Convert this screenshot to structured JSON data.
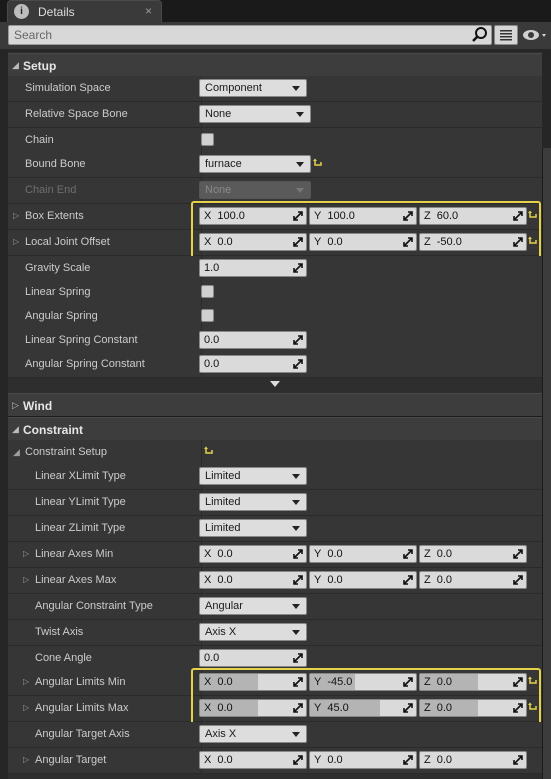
{
  "tab": {
    "title": "Details",
    "close": "×"
  },
  "search": {
    "placeholder": "Search"
  },
  "categories": {
    "setup": "Setup",
    "wind": "Wind",
    "constraint": "Constraint"
  },
  "setup": {
    "simulation_space": {
      "label": "Simulation Space",
      "value": "Component"
    },
    "relative_space_bone": {
      "label": "Relative Space Bone",
      "value": "None"
    },
    "chain": {
      "label": "Chain"
    },
    "bound_bone": {
      "label": "Bound Bone",
      "value": "furnace"
    },
    "chain_end": {
      "label": "Chain End",
      "value": "None"
    },
    "box_extents": {
      "label": "Box Extents",
      "x": "100.0",
      "y": "100.0",
      "z": "60.0"
    },
    "local_joint_offset": {
      "label": "Local Joint Offset",
      "x": "0.0",
      "y": "0.0",
      "z": "-50.0"
    },
    "gravity_scale": {
      "label": "Gravity Scale",
      "value": "1.0"
    },
    "linear_spring": {
      "label": "Linear Spring"
    },
    "angular_spring": {
      "label": "Angular Spring"
    },
    "linear_spring_constant": {
      "label": "Linear Spring Constant",
      "value": "0.0"
    },
    "angular_spring_constant": {
      "label": "Angular Spring Constant",
      "value": "0.0"
    }
  },
  "constraint": {
    "setup": {
      "label": "Constraint Setup"
    },
    "linear_xlimit_type": {
      "label": "Linear XLimit Type",
      "value": "Limited"
    },
    "linear_ylimit_type": {
      "label": "Linear YLimit Type",
      "value": "Limited"
    },
    "linear_zlimit_type": {
      "label": "Linear ZLimit Type",
      "value": "Limited"
    },
    "linear_axes_min": {
      "label": "Linear Axes Min",
      "x": "0.0",
      "y": "0.0",
      "z": "0.0"
    },
    "linear_axes_max": {
      "label": "Linear Axes Max",
      "x": "0.0",
      "y": "0.0",
      "z": "0.0"
    },
    "angular_constraint_type": {
      "label": "Angular Constraint Type",
      "value": "Angular"
    },
    "twist_axis": {
      "label": "Twist Axis",
      "value": "Axis X"
    },
    "cone_angle": {
      "label": "Cone Angle",
      "value": "0.0"
    },
    "angular_limits_min": {
      "label": "Angular Limits Min",
      "x": "0.0",
      "y": "-45.0",
      "z": "0.0"
    },
    "angular_limits_max": {
      "label": "Angular Limits Max",
      "x": "0.0",
      "y": "45.0",
      "z": "0.0"
    },
    "angular_target_axis": {
      "label": "Angular Target Axis",
      "value": "Axis X"
    },
    "angular_target": {
      "label": "Angular Target",
      "x": "0.0",
      "y": "0.0",
      "z": "0.0"
    }
  },
  "axis_labels": {
    "x": "X",
    "y": "Y",
    "z": "Z"
  },
  "colors": {
    "highlight": "#e5d24a",
    "reset_arrow": "#e5d24a"
  },
  "icons": [
    "details-icon",
    "close-icon",
    "search-icon",
    "list-view-icon",
    "eye-icon",
    "reset-to-default-icon",
    "drag-handle-icon",
    "expand-arrow-icon"
  ]
}
